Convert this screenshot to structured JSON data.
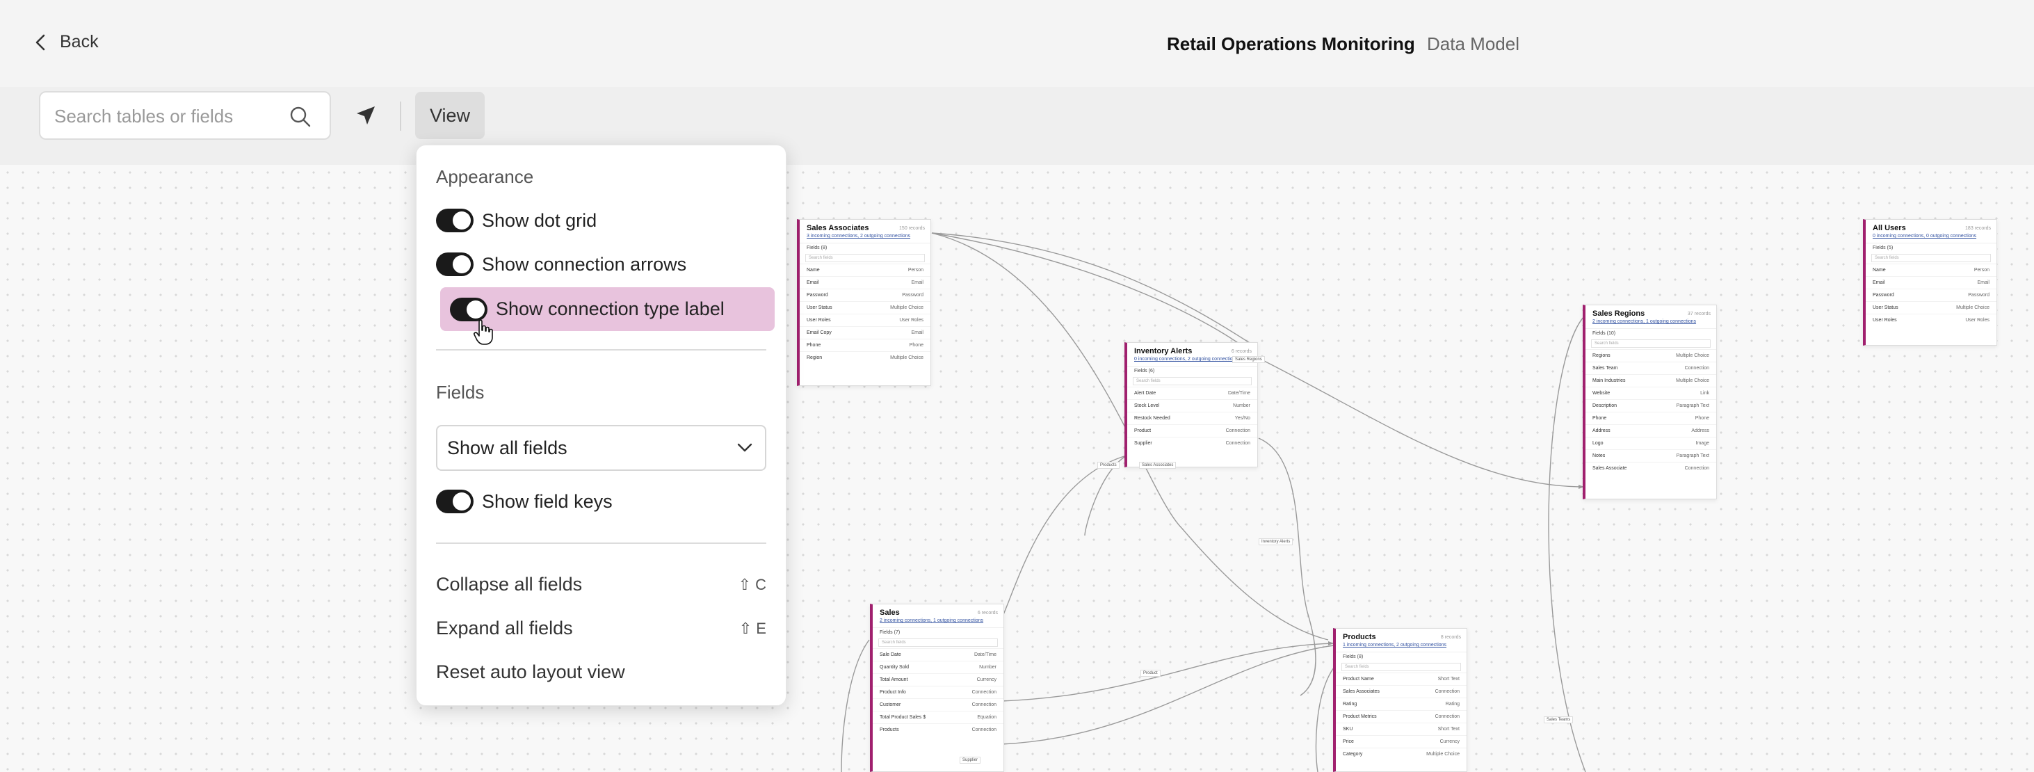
{
  "header": {
    "back_label": "Back",
    "title": "Retail Operations Monitoring",
    "subtitle": "Data Model"
  },
  "toolbar": {
    "search_placeholder": "Search tables or fields",
    "view_label": "View"
  },
  "view_menu": {
    "appearance_title": "Appearance",
    "toggles": [
      {
        "label": "Show dot grid",
        "on": true
      },
      {
        "label": "Show connection arrows",
        "on": true
      },
      {
        "label": "Show connection type label",
        "on": true,
        "highlighted": true
      }
    ],
    "fields_title": "Fields",
    "fields_select": "Show all fields",
    "show_field_keys": {
      "label": "Show field keys",
      "on": true
    },
    "actions": [
      {
        "label": "Collapse all fields",
        "shortcut": "⇧ C"
      },
      {
        "label": "Expand all fields",
        "shortcut": "⇧ E"
      },
      {
        "label": "Reset auto layout view",
        "shortcut": ""
      }
    ]
  },
  "colors": {
    "accent": "#a0206e",
    "highlight": "#e8c3dd",
    "toggle_on": "#1a1a1a"
  },
  "tables": {
    "sales_associates": {
      "name": "Sales Associates",
      "count": "150 records",
      "sub": "3 incoming connections, 2 outgoing connections",
      "fields_label": "Fields (8)",
      "search": "Search fields",
      "rows": [
        [
          "Name",
          "Person"
        ],
        [
          "Email",
          "Email"
        ],
        [
          "Password",
          "Password"
        ],
        [
          "User Status",
          "Multiple Choice"
        ],
        [
          "User Roles",
          "User Roles"
        ],
        [
          "Email Copy",
          "Email"
        ],
        [
          "Phone",
          "Phone"
        ],
        [
          "Region",
          "Multiple Choice"
        ]
      ]
    },
    "inventory_alerts": {
      "name": "Inventory Alerts",
      "count": "6 records",
      "sub": "0 incoming connections, 2 outgoing connections",
      "fields_label": "Fields (6)",
      "search": "Search fields",
      "rows": [
        [
          "Alert Date",
          "Date/Time"
        ],
        [
          "Stock Level",
          "Number"
        ],
        [
          "Restock Needed",
          "Yes/No"
        ],
        [
          "Product",
          "Connection"
        ],
        [
          "Supplier",
          "Connection"
        ]
      ]
    },
    "sales_regions": {
      "name": "Sales Regions",
      "count": "37 records",
      "sub": "2 incoming connections, 1 outgoing connections",
      "fields_label": "Fields (10)",
      "search": "Search fields",
      "rows": [
        [
          "Regions",
          "Multiple Choice"
        ],
        [
          "Sales Team",
          "Connection"
        ],
        [
          "Main Industries",
          "Multiple Choice"
        ],
        [
          "Website",
          "Link"
        ],
        [
          "Description",
          "Paragraph Text"
        ],
        [
          "Phone",
          "Phone"
        ],
        [
          "Address",
          "Address"
        ],
        [
          "Logo",
          "Image"
        ],
        [
          "Notes",
          "Paragraph Text"
        ],
        [
          "Sales Associate",
          "Connection"
        ]
      ]
    },
    "all_users": {
      "name": "All Users",
      "count": "183 records",
      "sub": "0 incoming connections, 0 outgoing connections",
      "fields_label": "Fields (5)",
      "search": "Search fields",
      "rows": [
        [
          "Name",
          "Person"
        ],
        [
          "Email",
          "Email"
        ],
        [
          "Password",
          "Password"
        ],
        [
          "User Status",
          "Multiple Choice"
        ],
        [
          "User Roles",
          "User Roles"
        ]
      ]
    },
    "sales": {
      "name": "Sales",
      "count": "6 records",
      "sub": "2 incoming connections, 1 outgoing connections",
      "fields_label": "Fields (7)",
      "search": "Search fields",
      "rows": [
        [
          "Sale Date",
          "Date/Time"
        ],
        [
          "Quantity Sold",
          "Number"
        ],
        [
          "Total Amount",
          "Currency"
        ],
        [
          "Product Info",
          "Connection"
        ],
        [
          "Customer",
          "Connection"
        ],
        [
          "Total Product Sales $",
          "Equation"
        ],
        [
          "Products",
          "Connection"
        ]
      ]
    },
    "products": {
      "name": "Products",
      "count": "8 records",
      "sub": "1 incoming connections, 2 outgoing connections",
      "fields_label": "Fields (8)",
      "search": "Search fields",
      "rows": [
        [
          "Product Name",
          "Short Text"
        ],
        [
          "Sales Associates",
          "Connection"
        ],
        [
          "Rating",
          "Rating"
        ],
        [
          "Product Metrics",
          "Connection"
        ],
        [
          "SKU",
          "Short Text"
        ],
        [
          "Price",
          "Currency"
        ],
        [
          "Category",
          "Multiple Choice"
        ]
      ]
    }
  },
  "edge_labels": [
    "Products",
    "Sales Associates",
    "Sales Regions",
    "Inventory Alerts",
    "Product",
    "Sales Teams",
    "Supplier"
  ]
}
